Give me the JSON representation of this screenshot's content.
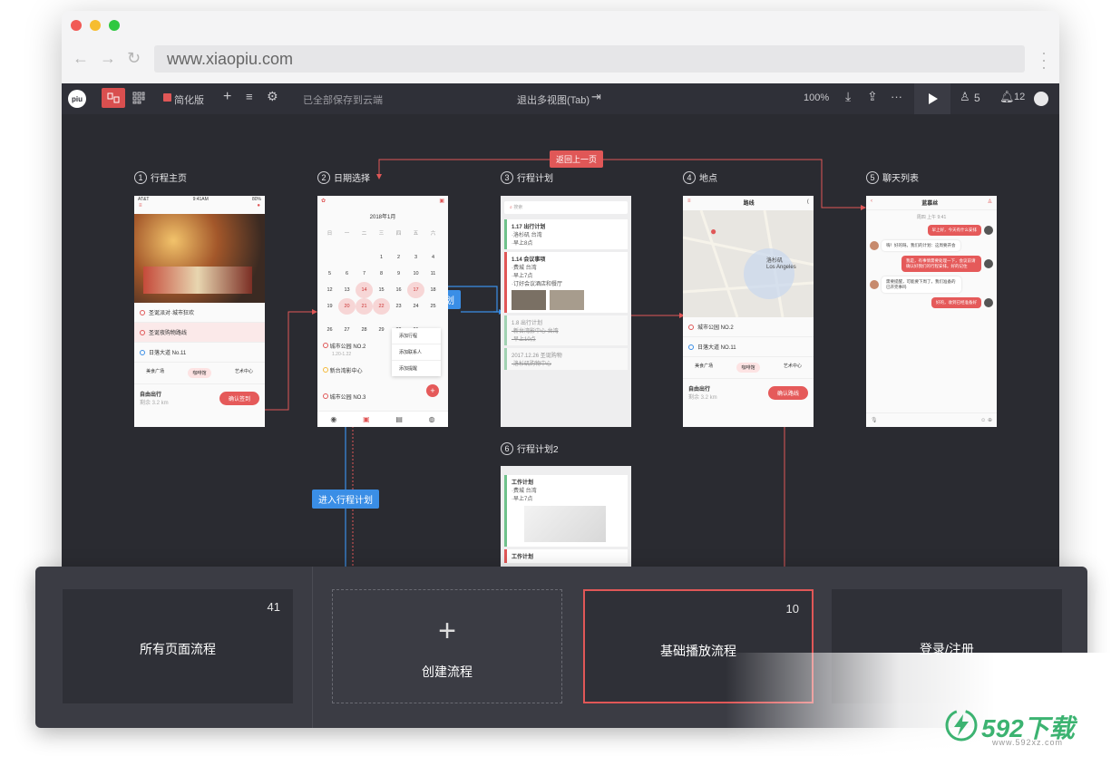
{
  "browser": {
    "url": "www.xiaopiu.com"
  },
  "toolbar": {
    "logo": "piu",
    "simplified_label": "简化版",
    "saved_status": "已全部保存到云端",
    "exit_multiview": "退出多视图(Tab)",
    "zoom": "100%",
    "more": "···",
    "users_count": "5",
    "notifications_count": "12"
  },
  "pages": [
    {
      "num": "1",
      "title": "行程主页"
    },
    {
      "num": "2",
      "title": "日期选择"
    },
    {
      "num": "3",
      "title": "行程计划"
    },
    {
      "num": "4",
      "title": "地点"
    },
    {
      "num": "5",
      "title": "聊天列表"
    },
    {
      "num": "6",
      "title": "行程计划2"
    }
  ],
  "links": {
    "back_prev": "返回上一页",
    "enter_plan": "进入行程计划",
    "enter_plan2": "进入行程计划"
  },
  "phone1": {
    "status_left": "AT&T",
    "status_time": "9:41AM",
    "status_right": "80%",
    "items": [
      "圣诞派对·城市狂欢",
      "圣诞夜购物路线",
      "日落大道 No.11"
    ],
    "cats": [
      "美食广场",
      "咖啡馆",
      "艺术中心"
    ],
    "bottom_title": "自由出行",
    "bottom_sub": "剩余 3.2 km",
    "btn": "确认签到"
  },
  "phone2": {
    "month": "2018年1月",
    "weekdays": [
      "日",
      "一",
      "二",
      "三",
      "四",
      "五",
      "六"
    ],
    "rows": [
      [
        "",
        "",
        "",
        "1",
        "2",
        "3",
        "4"
      ],
      [
        "5",
        "6",
        "7",
        "8",
        "9",
        "10",
        "11"
      ],
      [
        "12",
        "13",
        "14",
        "15",
        "16",
        "17",
        "18"
      ],
      [
        "19",
        "20",
        "21",
        "22",
        "23",
        "24",
        "25"
      ],
      [
        "26",
        "27",
        "28",
        "29",
        "30",
        "31",
        ""
      ]
    ],
    "items": [
      "城市公园 NO.2",
      "新台湾影中心",
      "城市公园 NO.3"
    ],
    "times": [
      "1.20-1.22",
      ""
    ],
    "menu": [
      "添加行程",
      "添加联系人",
      "添加提醒"
    ]
  },
  "phone3": {
    "search": "搜索",
    "cards": [
      {
        "title": "1.17 出行计划",
        "l1": "·洛杉矶 台湾",
        "l2": "·早上8点"
      },
      {
        "title": "1.14 会议事项",
        "l1": "·费城 台湾",
        "l2": "·早上7点",
        "l3": "·订好会议酒店和餐厅"
      },
      {
        "title": "1.8 出行计划",
        "l1": "·新台湾影中心 台湾",
        "l2": "·早上10点"
      },
      {
        "title": "2017.12.26 圣诞购物",
        "l1": "·洛杉矶购物中心"
      }
    ]
  },
  "phone4": {
    "title": "路线",
    "map_label": "洛杉矶",
    "map_label2": "Los Angeles",
    "items": [
      "城市公园 NO.2",
      "日落大道 NO.11"
    ],
    "cats": [
      "美食广场",
      "咖啡馆",
      "艺术中心"
    ],
    "bottom_title": "自由出行",
    "bottom_sub": "剩余 3.2 km",
    "btn": "确认路线"
  },
  "phone5": {
    "title": "蓝慕丝",
    "time": "周四 上午 9:41",
    "msgs": [
      {
        "side": "right",
        "text": "早上好，今天有什么安排"
      },
      {
        "side": "left",
        "text": "嗨！好的呀。我们的计划：这周要开会"
      },
      {
        "side": "right",
        "text": "我是，有事情需要处理一下，会议前请确认好我们的行程安排。好的记住"
      },
      {
        "side": "left",
        "text": "需要提醒，可能要下周了，我们准备的已开完事吗"
      },
      {
        "side": "right",
        "text": "好的，收到已经准备好"
      }
    ]
  },
  "phone6": {
    "cards": [
      {
        "title": "工作计划",
        "l1": "·费城 台湾",
        "l2": "·早上7点"
      },
      {
        "title": "工作计划"
      }
    ]
  },
  "flows": [
    {
      "label": "所有页面流程",
      "count": "41"
    },
    {
      "label": "创建流程",
      "icon": "+"
    },
    {
      "label": "基础播放流程",
      "count": "10"
    },
    {
      "label": "登录/注册"
    }
  ],
  "watermark": {
    "brand": "592下载",
    "url": "www.592xz.com"
  }
}
